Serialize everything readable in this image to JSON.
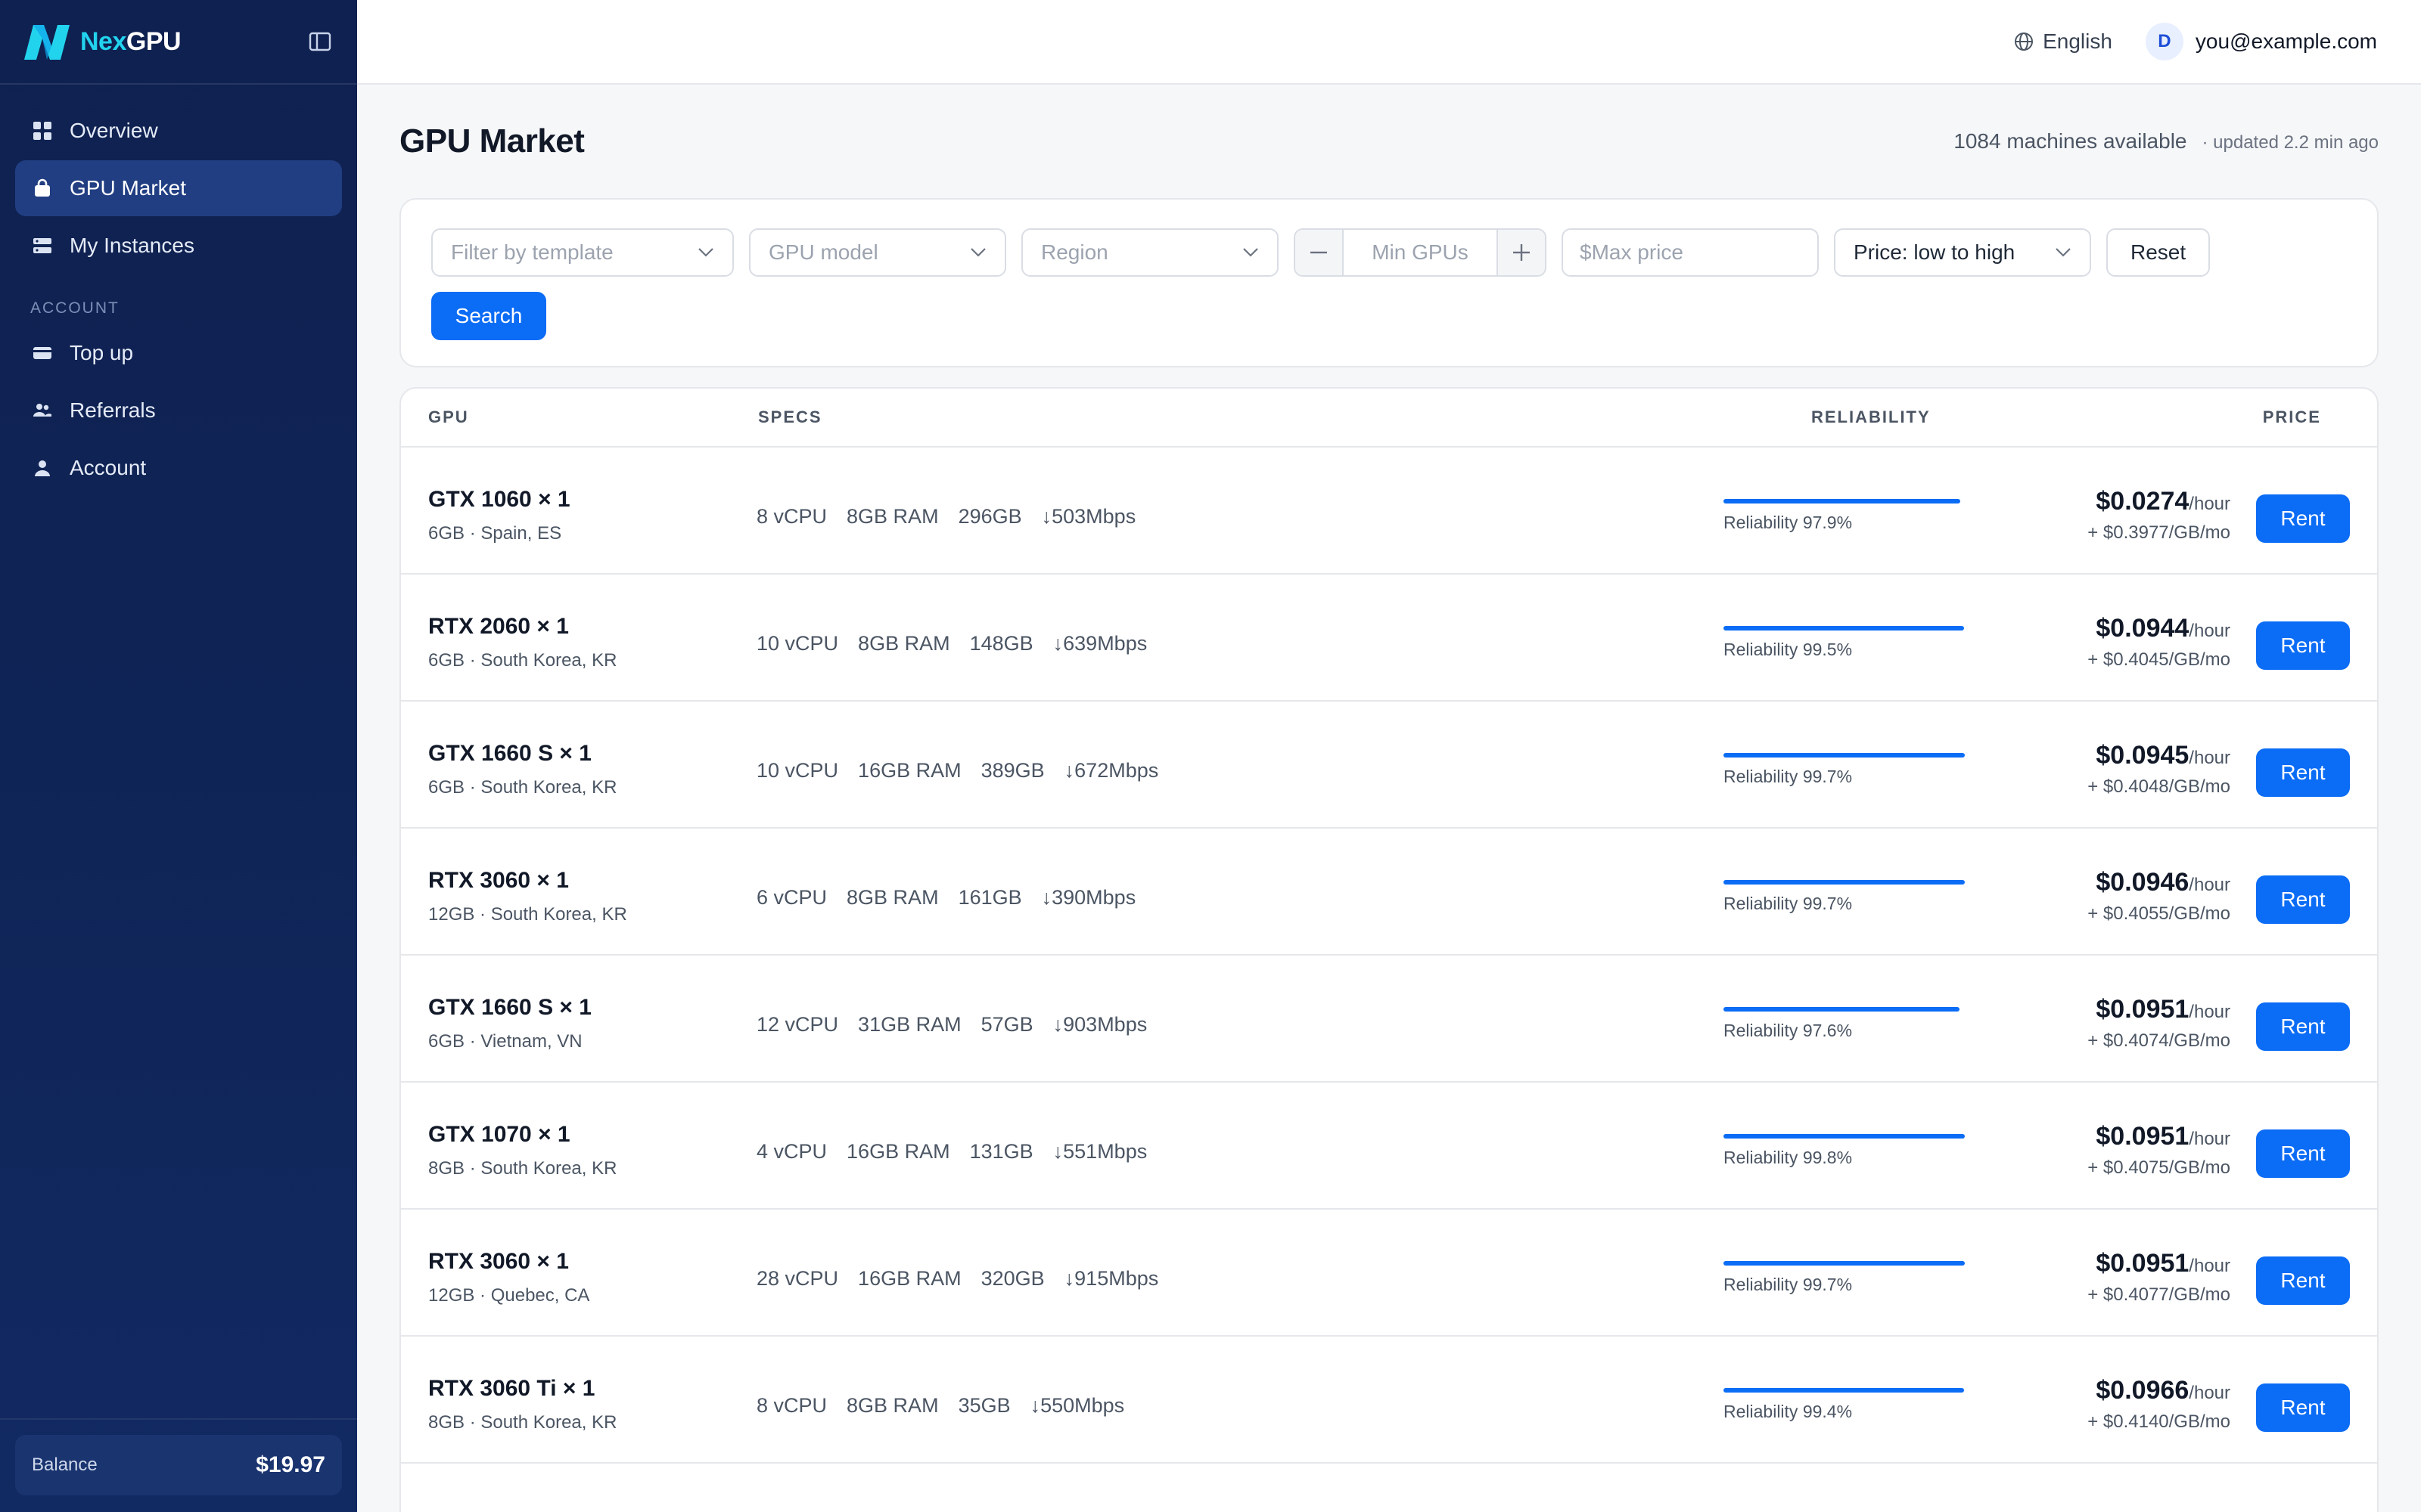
{
  "brand": {
    "name_a": "Nex",
    "name_b": "GPU"
  },
  "nav": {
    "items": [
      {
        "label": "Overview",
        "icon": "grid-icon"
      },
      {
        "label": "GPU Market",
        "icon": "bag-icon",
        "active": true
      },
      {
        "label": "My Instances",
        "icon": "server-icon"
      }
    ],
    "section_label": "ACCOUNT",
    "account_items": [
      {
        "label": "Top up",
        "icon": "card-icon"
      },
      {
        "label": "Referrals",
        "icon": "users-icon"
      },
      {
        "label": "Account",
        "icon": "user-icon"
      }
    ]
  },
  "balance": {
    "label": "Balance",
    "value": "$19.97"
  },
  "topbar": {
    "language": "English",
    "avatar_initial": "D",
    "email": "you@example.com"
  },
  "page": {
    "title": "GPU Market",
    "available": "1084 machines available",
    "updated": "· updated 2.2 min ago"
  },
  "filters": {
    "template_placeholder": "Filter by template",
    "gpu_model_placeholder": "GPU model",
    "region_placeholder": "Region",
    "min_gpus_placeholder": "Min GPUs",
    "max_price_placeholder": "$Max price",
    "sort_value": "Price: low to high",
    "reset_label": "Reset",
    "search_label": "Search"
  },
  "table": {
    "headers": {
      "gpu": "GPU",
      "specs": "SPECS",
      "reliability": "RELIABILITY",
      "price": "PRICE"
    },
    "rent_label": "Rent",
    "rows": [
      {
        "name": "GTX 1060 × 1",
        "sub": "6GB · Spain, ES",
        "cpu": "8 vCPU",
        "ram": "8GB RAM",
        "disk": "296GB",
        "net": "↓503Mbps",
        "reliability": "Reliability 97.9%",
        "rel_value": 0.979,
        "price": "$0.0274",
        "unit": "/hour",
        "storage": "+ $0.3977/GB/mo"
      },
      {
        "name": "RTX 2060 × 1",
        "sub": "6GB · South Korea, KR",
        "cpu": "10 vCPU",
        "ram": "8GB RAM",
        "disk": "148GB",
        "net": "↓639Mbps",
        "reliability": "Reliability 99.5%",
        "rel_value": 0.995,
        "price": "$0.0944",
        "unit": "/hour",
        "storage": "+ $0.4045/GB/mo"
      },
      {
        "name": "GTX 1660 S × 1",
        "sub": "6GB · South Korea, KR",
        "cpu": "10 vCPU",
        "ram": "16GB RAM",
        "disk": "389GB",
        "net": "↓672Mbps",
        "reliability": "Reliability 99.7%",
        "rel_value": 0.997,
        "price": "$0.0945",
        "unit": "/hour",
        "storage": "+ $0.4048/GB/mo"
      },
      {
        "name": "RTX 3060 × 1",
        "sub": "12GB · South Korea, KR",
        "cpu": "6 vCPU",
        "ram": "8GB RAM",
        "disk": "161GB",
        "net": "↓390Mbps",
        "reliability": "Reliability 99.7%",
        "rel_value": 0.997,
        "price": "$0.0946",
        "unit": "/hour",
        "storage": "+ $0.4055/GB/mo"
      },
      {
        "name": "GTX 1660 S × 1",
        "sub": "6GB · Vietnam, VN",
        "cpu": "12 vCPU",
        "ram": "31GB RAM",
        "disk": "57GB",
        "net": "↓903Mbps",
        "reliability": "Reliability 97.6%",
        "rel_value": 0.976,
        "price": "$0.0951",
        "unit": "/hour",
        "storage": "+ $0.4074/GB/mo"
      },
      {
        "name": "GTX 1070 × 1",
        "sub": "8GB · South Korea, KR",
        "cpu": "4 vCPU",
        "ram": "16GB RAM",
        "disk": "131GB",
        "net": "↓551Mbps",
        "reliability": "Reliability 99.8%",
        "rel_value": 0.998,
        "price": "$0.0951",
        "unit": "/hour",
        "storage": "+ $0.4075/GB/mo"
      },
      {
        "name": "RTX 3060 × 1",
        "sub": "12GB · Quebec, CA",
        "cpu": "28 vCPU",
        "ram": "16GB RAM",
        "disk": "320GB",
        "net": "↓915Mbps",
        "reliability": "Reliability 99.7%",
        "rel_value": 0.997,
        "price": "$0.0951",
        "unit": "/hour",
        "storage": "+ $0.4077/GB/mo"
      },
      {
        "name": "RTX 3060 Ti × 1",
        "sub": "8GB · South Korea, KR",
        "cpu": "8 vCPU",
        "ram": "8GB RAM",
        "disk": "35GB",
        "net": "↓550Mbps",
        "reliability": "Reliability 99.4%",
        "rel_value": 0.994,
        "price": "$0.0966",
        "unit": "/hour",
        "storage": "+ $0.4140/GB/mo"
      }
    ]
  },
  "colors": {
    "accent": "#0b6cf5",
    "sidebar": "#0f2150",
    "sidebar_active": "#213e82"
  }
}
